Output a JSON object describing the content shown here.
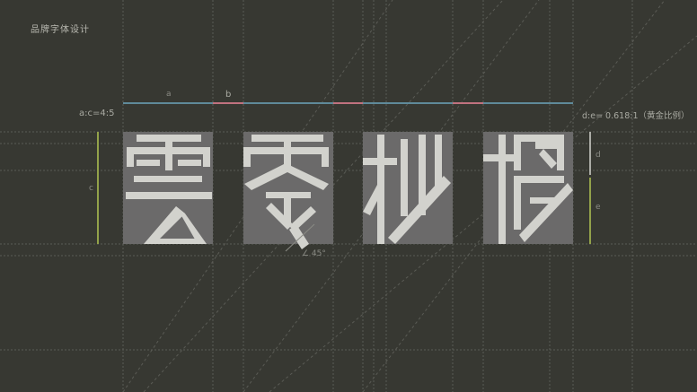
{
  "header": {
    "title": "品牌字体设计"
  },
  "labels": {
    "a": "a",
    "b": "b",
    "c": "c",
    "d": "d",
    "e": "e",
    "ratio_ac": "a:c=4:5",
    "ratio_de": "d:e= 0.618:1（黄金比例）",
    "angle": "∠ 45°"
  },
  "glyphs": [
    "雲",
    "零",
    "杪",
    "椤"
  ],
  "colors": {
    "background": "#373832",
    "glyph_box": "#6b6a6a",
    "stroke": "#d2d2cd",
    "guide_blue": "#5f8a9a",
    "guide_pink": "#c0727f",
    "guide_green": "#93a24a",
    "grid": "#5a5b55"
  }
}
